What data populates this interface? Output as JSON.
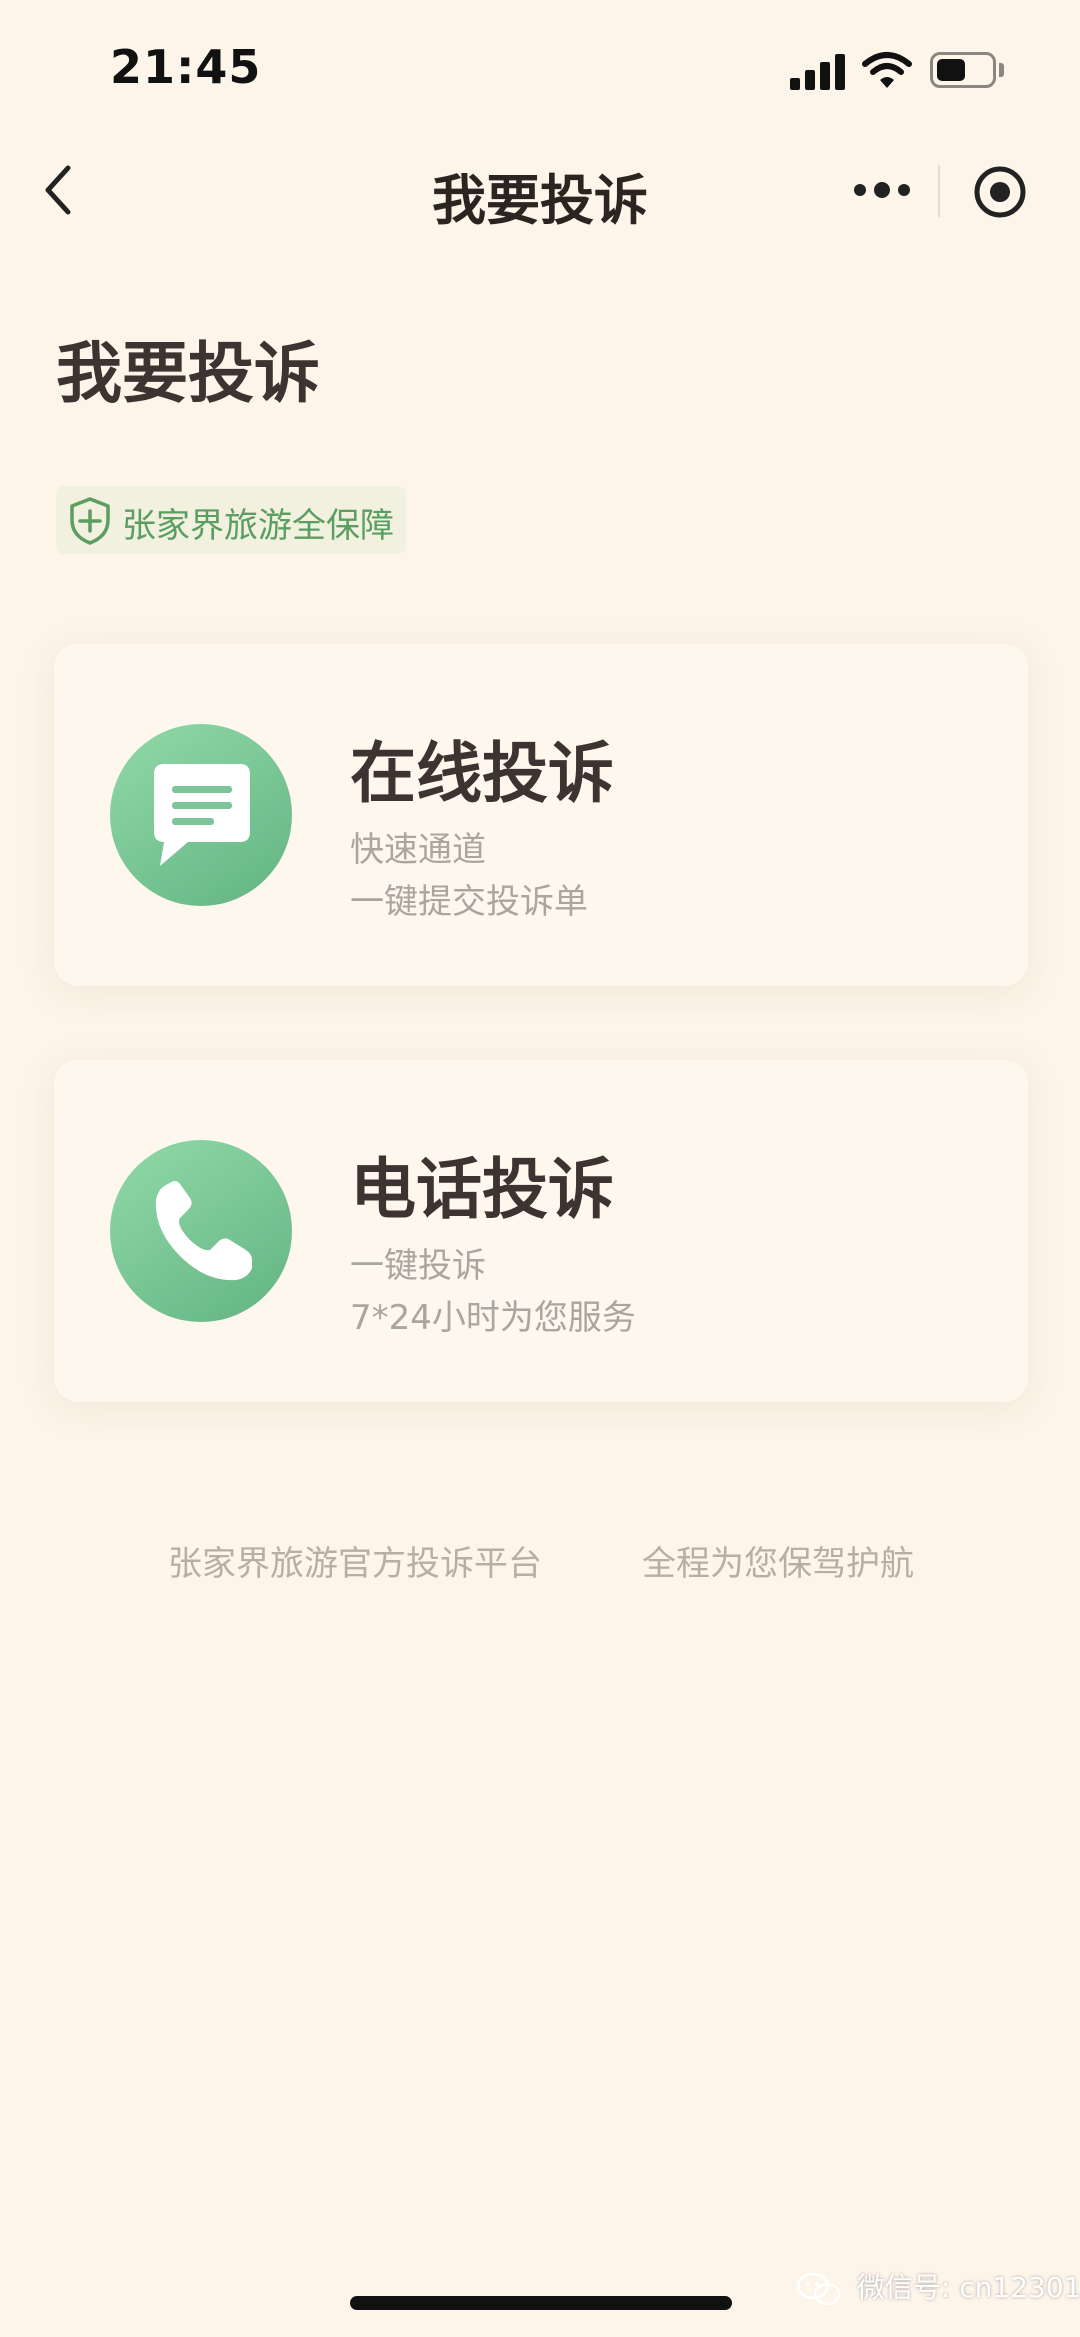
{
  "status_bar": {
    "time": "21:45",
    "icons": [
      "signal-icon",
      "wifi-icon",
      "battery-icon"
    ]
  },
  "nav": {
    "title": "我要投诉",
    "icons": [
      "back-arrow-icon",
      "more-dots-icon",
      "target-icon"
    ]
  },
  "page": {
    "heading": "我要投诉",
    "badge_text": "张家界旅游全保障",
    "badge_icon": "shield-plus-icon"
  },
  "options": [
    {
      "title": "在线投诉",
      "line1": "快速通道",
      "line2": "一键提交投诉单",
      "icon": "chat-bubble-icon"
    },
    {
      "title": "电话投诉",
      "line1": "一键投诉",
      "line2": "7*24小时为您服务",
      "icon": "phone-icon"
    }
  ],
  "footer": {
    "left": "张家界旅游官方投诉平台",
    "right": "全程为您保驾护航"
  },
  "watermark": "微信号: cn12301",
  "colors": {
    "background": "#fdf5ea",
    "accent_green": "#5a9e62",
    "icon_green_light": "#92d9a9",
    "icon_green_dark": "#62b482",
    "title_text": "#3d3330",
    "muted_text": "#aba59c"
  }
}
